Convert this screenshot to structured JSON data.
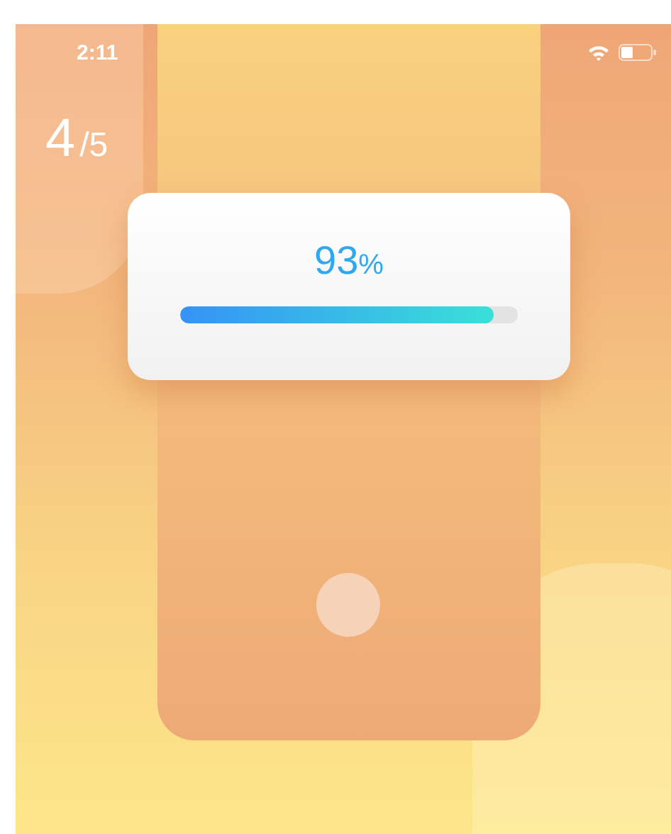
{
  "status_bar": {
    "time": "2:11"
  },
  "step": {
    "current": "4",
    "total": "/5"
  },
  "progress": {
    "value": "93",
    "unit": "%",
    "level": 0.93
  }
}
